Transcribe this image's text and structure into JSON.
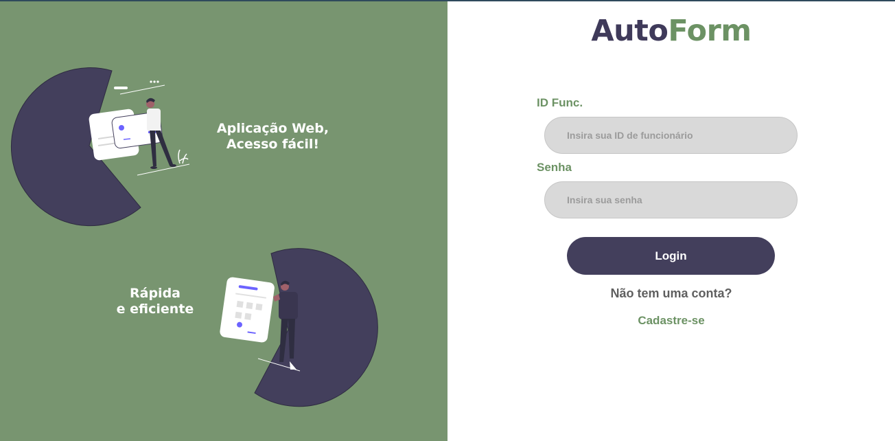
{
  "brand": {
    "part1": "Auto",
    "part2": "Form"
  },
  "illustration": {
    "caption_top": "Aplicação Web,\nAcesso fácil!",
    "caption_bottom": "Rápida\ne eficiente",
    "colors": {
      "panel": "#789570",
      "accent_dark": "#433f5c",
      "accent_purple": "#6c63ff"
    }
  },
  "form": {
    "id_label": "ID Func.",
    "id_placeholder": "Insira sua ID de funcionário",
    "password_label": "Senha",
    "password_placeholder": "Insira sua senha",
    "login_label": "Login",
    "no_account_text": "Não tem uma conta?",
    "signup_label": "Cadastre-se"
  },
  "colors": {
    "brand_dark": "#3f3a5a",
    "brand_green": "#6c9264",
    "input_bg": "#d9d9d9",
    "button_bg": "#433f5c"
  }
}
